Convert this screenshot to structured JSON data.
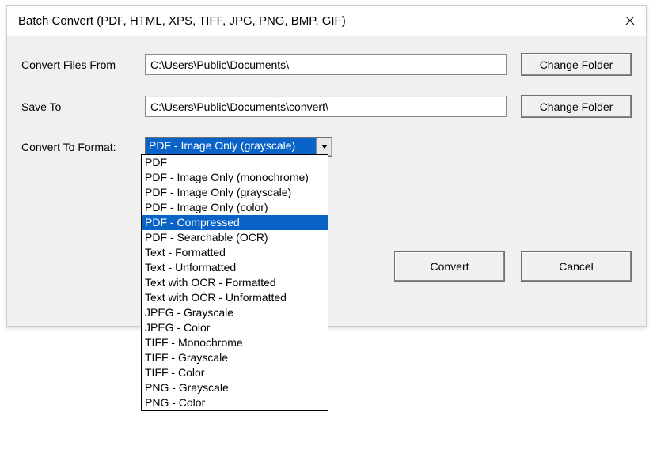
{
  "window": {
    "title": "Batch Convert (PDF, HTML, XPS, TIFF, JPG, PNG, BMP, GIF)"
  },
  "labels": {
    "from": "Convert Files From",
    "saveTo": "Save To",
    "format": "Convert To Format:"
  },
  "values": {
    "from": "C:\\Users\\Public\\Documents\\",
    "saveTo": "C:\\Users\\Public\\Documents\\convert\\",
    "formatSelected": "PDF - Image Only (grayscale)"
  },
  "buttons": {
    "changeFolder": "Change Folder",
    "convert": "Convert",
    "cancel": "Cancel"
  },
  "dropdown": {
    "highlightedIndex": 4,
    "options": [
      "PDF",
      "PDF - Image Only (monochrome)",
      "PDF - Image Only (grayscale)",
      "PDF - Image Only (color)",
      "PDF - Compressed",
      "PDF - Searchable (OCR)",
      "Text - Formatted",
      "Text - Unformatted",
      "Text with OCR - Formatted",
      "Text with OCR - Unformatted",
      "JPEG - Grayscale",
      "JPEG - Color",
      "TIFF - Monochrome",
      "TIFF - Grayscale",
      "TIFF - Color",
      "PNG - Grayscale",
      "PNG - Color"
    ]
  }
}
